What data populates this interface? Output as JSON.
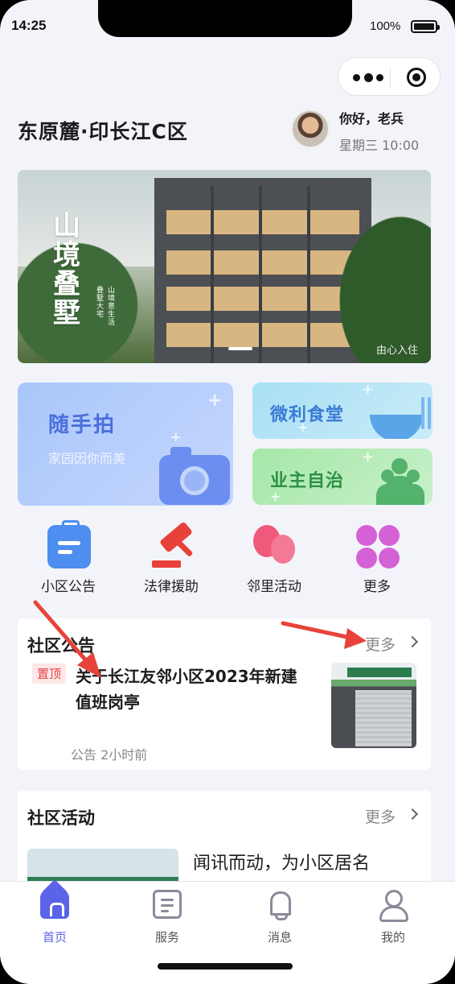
{
  "status_bar": {
    "time": "14:25",
    "battery": "100%"
  },
  "header": {
    "community_name": "东原麓·印长江C区",
    "greeting": "你好，老兵",
    "date": "星期三 10:00"
  },
  "banner": {
    "calligraphy": "山境叠墅",
    "sub_line_1": "叠墅大宅",
    "sub_line_2": "山境意生活",
    "watermark": "由心入住"
  },
  "features": {
    "snap": {
      "title": "随手拍",
      "subtitle": "家园因你而美"
    },
    "canteen": {
      "title": "微利食堂"
    },
    "owners": {
      "title": "业主自治"
    }
  },
  "quick_links": [
    {
      "label": "小区公告",
      "icon": "notice-clipboard-icon"
    },
    {
      "label": "法律援助",
      "icon": "gavel-icon"
    },
    {
      "label": "邻里活动",
      "icon": "balloons-icon"
    },
    {
      "label": "更多",
      "icon": "clover-grid-icon"
    }
  ],
  "notice_section": {
    "title": "社区公告",
    "more": "更多",
    "item": {
      "badge": "置顶",
      "title": "关于长江友邻小区2023年新建值班岗亭",
      "meta": "公告 2小时前"
    }
  },
  "activity_section": {
    "title": "社区活动",
    "more": "更多",
    "item": {
      "title": "闻讯而动，为小区居名"
    }
  },
  "tabbar": [
    {
      "label": "首页",
      "icon": "home-icon",
      "active": true
    },
    {
      "label": "服务",
      "icon": "document-icon",
      "active": false
    },
    {
      "label": "消息",
      "icon": "bell-icon",
      "active": false
    },
    {
      "label": "我的",
      "icon": "user-icon",
      "active": false
    }
  ],
  "colors": {
    "accent": "#5b63e8",
    "annotation_arrow": "#e8433a",
    "pin_badge": "#e24848"
  }
}
